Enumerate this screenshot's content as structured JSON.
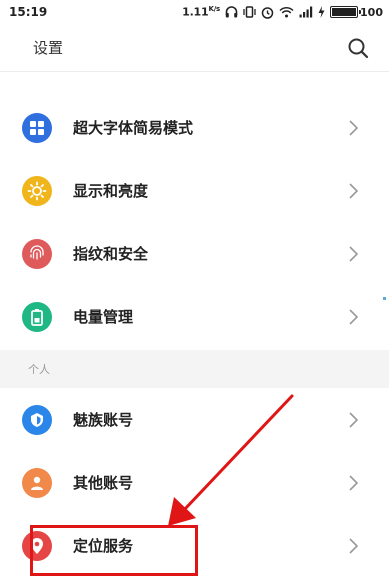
{
  "status_bar": {
    "time": "15:19",
    "speed": "1.11",
    "speed_unit": "K/s",
    "battery": "100",
    "icons": [
      "headphones-icon",
      "vibrate-icon",
      "alarm-icon",
      "wifi-icon",
      "signal-icon",
      "charging-icon",
      "battery-icon"
    ]
  },
  "header": {
    "title": "设置",
    "search_icon": "search-icon"
  },
  "rows": [
    {
      "label": "超大字体简易模式",
      "icon": "grid-icon",
      "color": "#2f6fde"
    },
    {
      "label": "显示和亮度",
      "icon": "sun-icon",
      "color": "#f1b51c"
    },
    {
      "label": "指纹和安全",
      "icon": "fingerprint-icon",
      "color": "#df5b5b"
    },
    {
      "label": "电量管理",
      "icon": "battery-icon",
      "color": "#1fb884"
    }
  ],
  "section": {
    "title": "个人"
  },
  "personal_rows": [
    {
      "label": "魅族账号",
      "icon": "account-shield-icon",
      "color": "#2a86e8"
    },
    {
      "label": "其他账号",
      "icon": "person-icon",
      "color": "#f1894a"
    },
    {
      "label": "定位服务",
      "icon": "location-icon",
      "color": "#e64545"
    }
  ],
  "colors": {
    "annotation": "#e01515",
    "peek_icon": "#2fc3a2"
  }
}
